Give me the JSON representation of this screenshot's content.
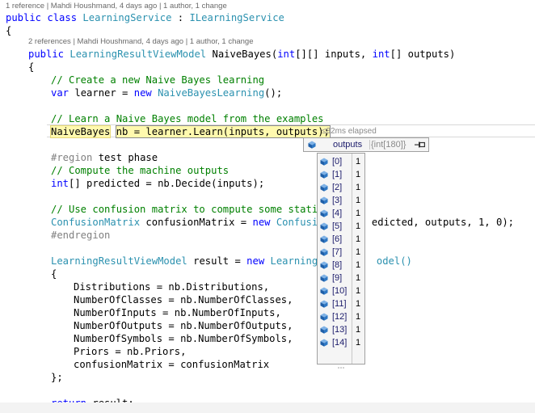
{
  "lens_class": "1 reference | Mahdi Houshmand, 4 days ago | 1 author, 1 change",
  "lens_method": "2 references | Mahdi Houshmand, 4 days ago | 1 author, 1 change",
  "code": {
    "l1_kw": "public class ",
    "l1_type": "LearningService",
    "l1_mid": " : ",
    "l1_iface": "ILearningService",
    "l2": "{",
    "l3_kw": "public ",
    "l3_type": "LearningResultViewModel",
    "l3_a": " NaiveBayes(",
    "l3_kw2": "int",
    "l3_b": "[][] inputs, ",
    "l3_kw3": "int",
    "l3_c": "[] outputs)",
    "l4": "{",
    "l5": "// Create a new Naive Bayes learning",
    "l6_kw": "var",
    "l6_a": " learner = ",
    "l6_kw2": "new",
    "l6_sp": " ",
    "l6_type": "NaiveBayesLearning",
    "l6_b": "();",
    "l7": "// Learn a Naive Bayes model from the examples",
    "l8_hl": "NaiveBayes",
    "l8_sp": " ",
    "l8_sel": "nb = learner.Learn(inputs, outputs);",
    "elapsed": "≤82ms elapsed",
    "l9_kw": "#region",
    "l9_a": " test phase",
    "l10": "// Compute the machine outputs",
    "l11_kw": "int",
    "l11_a": "[] predicted = nb.Decide(inputs);",
    "l12": "// Use confusion matrix to compute some statist",
    "l13_type": "ConfusionMatrix",
    "l13_a": " confusionMatrix = ",
    "l13_kw": "new",
    "l13_sp": " ",
    "l13_type2": "Confusion",
    "l13_b": "edicted, outputs, 1, 0);",
    "l14": "#endregion",
    "l15_type": "LearningResultViewModel",
    "l15_a": " result = ",
    "l15_kw": "new",
    "l15_sp": " ",
    "l15_type2": "LearningRe",
    "l15_b": "odel()",
    "l16": "{",
    "l17": "Distributions = nb.Distributions,",
    "l18": "NumberOfClasses = nb.NumberOfClasses,",
    "l19": "NumberOfInputs = nb.NumberOfInputs,",
    "l20": "NumberOfOutputs = nb.NumberOfOutputs,",
    "l21": "NumberOfSymbols = nb.NumberOfSymbols,",
    "l22": "Priors = nb.Priors,",
    "l23": "confusionMatrix = confusionMatrix",
    "l24": "};",
    "l25_kw": "return",
    "l25_a": " result;"
  },
  "datatip": {
    "name": "outputs",
    "value": "{int[180]}",
    "pin_icon": "pin-icon",
    "item_icon": "field-cube-icon",
    "rows": [
      {
        "index": "[0]",
        "value": "1"
      },
      {
        "index": "[1]",
        "value": "1"
      },
      {
        "index": "[2]",
        "value": "1"
      },
      {
        "index": "[3]",
        "value": "1"
      },
      {
        "index": "[4]",
        "value": "1"
      },
      {
        "index": "[5]",
        "value": "1"
      },
      {
        "index": "[6]",
        "value": "1"
      },
      {
        "index": "[7]",
        "value": "1"
      },
      {
        "index": "[8]",
        "value": "1"
      },
      {
        "index": "[9]",
        "value": "1"
      },
      {
        "index": "[10]",
        "value": "1"
      },
      {
        "index": "[11]",
        "value": "1"
      },
      {
        "index": "[12]",
        "value": "1"
      },
      {
        "index": "[13]",
        "value": "1"
      },
      {
        "index": "[14]",
        "value": "1"
      }
    ]
  },
  "colors": {
    "keyword": "#0000ff",
    "type": "#2b91af",
    "comment": "#008000",
    "highlight": "#fff9ae"
  }
}
